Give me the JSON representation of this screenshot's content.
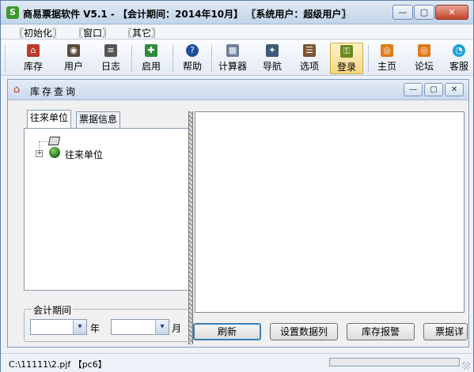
{
  "app": {
    "title": "商易票据软件 V5.1 - 【会计期间：2014年10月】 〖系统用户：超级用户〗",
    "icon": "app-logo-icon"
  },
  "window_buttons": {
    "minimize": "—",
    "maximize": "▢",
    "close": "✕"
  },
  "menu": {
    "items": [
      {
        "label": "〖初始化〗"
      },
      {
        "label": "〖窗口〗"
      },
      {
        "label": "〖其它〗"
      }
    ]
  },
  "toolbar": {
    "items": [
      {
        "label": "库存",
        "icon": "home-icon",
        "glyph": "⌂",
        "color": "#c0392b"
      },
      {
        "label": "用户",
        "icon": "user-icon",
        "glyph": "◉",
        "color": "#5d4a3a"
      },
      {
        "label": "日志",
        "icon": "log-icon",
        "glyph": "≡",
        "color": "#555555"
      },
      {
        "label": "启用",
        "icon": "enable-icon",
        "glyph": "✚",
        "color": "#2e8b3a"
      },
      {
        "label": "帮助",
        "icon": "help-icon",
        "glyph": "?",
        "color": "#1f4e9c"
      },
      {
        "label": "计算器",
        "icon": "calculator-icon",
        "glyph": "▦",
        "color": "#6d7f99"
      },
      {
        "label": "导航",
        "icon": "navigation-icon",
        "glyph": "✦",
        "color": "#3c5a7a"
      },
      {
        "label": "选项",
        "icon": "options-icon",
        "glyph": "☰",
        "color": "#7a5533"
      },
      {
        "label": "登录",
        "icon": "login-key-icon",
        "glyph": "⚿",
        "color": "#6b8a1f"
      },
      {
        "label": "主页",
        "icon": "rss-home-icon",
        "glyph": "◎",
        "color": "#e07b19"
      },
      {
        "label": "论坛",
        "icon": "forum-icon",
        "glyph": "◎",
        "color": "#e07b19"
      },
      {
        "label": "客服",
        "icon": "support-icon",
        "glyph": "◔",
        "color": "#1aa3d6"
      }
    ]
  },
  "inner_window": {
    "title": "库存查询",
    "buttons": {
      "minimize": "—",
      "maximize": "▢",
      "close": "✕"
    }
  },
  "tabs": [
    {
      "label": "往来单位",
      "active": true
    },
    {
      "label": "票据信息",
      "active": false
    }
  ],
  "tree": {
    "expander": "+",
    "node_label": "往来单位"
  },
  "period": {
    "legend": "会计期间",
    "year_value": "",
    "year_unit": "年",
    "month_value": "",
    "month_unit": "月",
    "dropdown_glyph": "▾"
  },
  "buttons": {
    "refresh": "刷新",
    "set_columns": "设置数据列",
    "stock_alert": "库存报警",
    "bill_detail": "票据详"
  },
  "status": {
    "path": "C:\\11111\\2.pjf  【pc6】"
  }
}
